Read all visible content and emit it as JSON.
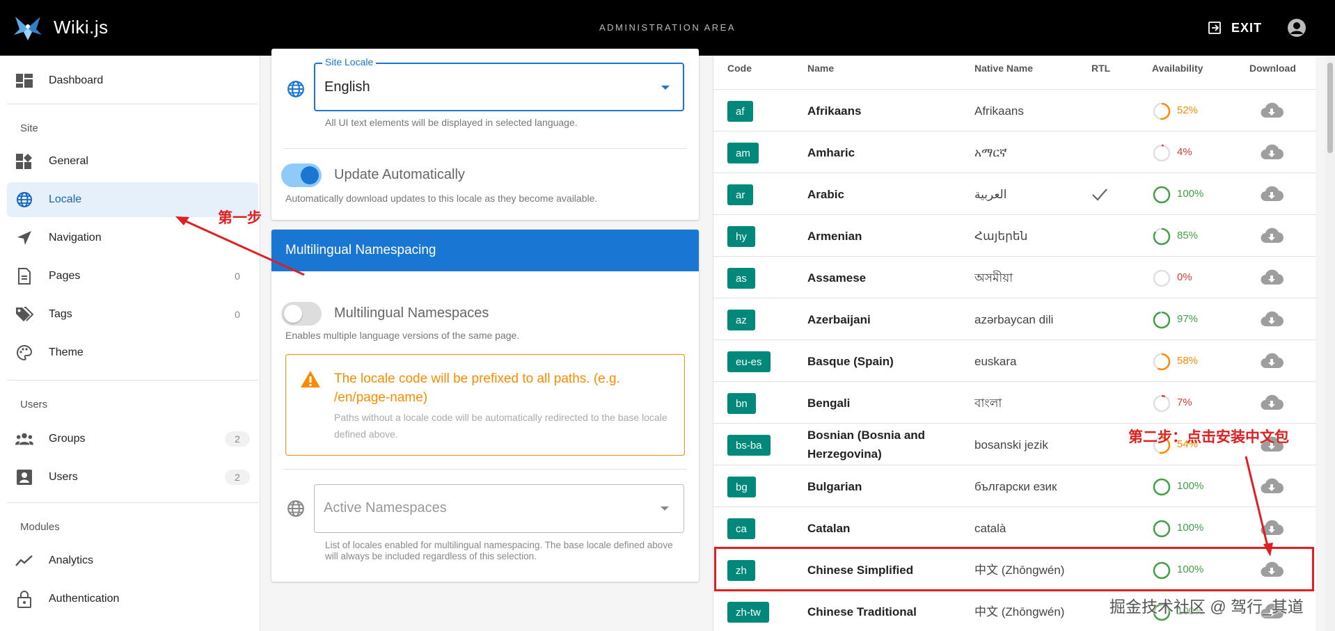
{
  "header": {
    "app_title": "Wiki.js",
    "admin_area": "ADMINISTRATION AREA",
    "exit_label": "EXIT"
  },
  "sidebar": {
    "dashboard": "Dashboard",
    "site_section": "Site",
    "general": "General",
    "locale": "Locale",
    "navigation": "Navigation",
    "pages": "Pages",
    "pages_count": "0",
    "tags": "Tags",
    "tags_count": "0",
    "theme": "Theme",
    "users_section": "Users",
    "groups": "Groups",
    "groups_count": "2",
    "users": "Users",
    "users_count": "2",
    "modules_section": "Modules",
    "analytics": "Analytics",
    "authentication": "Authentication"
  },
  "locale_card": {
    "site_locale_legend": "Site Locale",
    "site_locale_value": "English",
    "site_locale_hint": "All UI text elements will be displayed in selected language.",
    "update_label": "Update Automatically",
    "update_hint": "Automatically download updates to this locale as they become available.",
    "update_on": true
  },
  "namespace_card": {
    "header": "Multilingual Namespacing",
    "toggle_label": "Multilingual Namespaces",
    "toggle_hint": "Enables multiple language versions of the same page.",
    "alert_title": "The locale code will be prefixed to all paths. (e.g. /en/page-name)",
    "alert_body": "Paths without a locale code will be automatically redirected to the base locale defined above.",
    "active_ns_placeholder": "Active Namespaces",
    "active_ns_hint": "List of locales enabled for multilingual namespacing. The base locale defined above will always be included regardless of this selection."
  },
  "table": {
    "headers": [
      "Code",
      "Name",
      "Native Name",
      "RTL",
      "Availability",
      "Download"
    ],
    "rows": [
      {
        "code": "af",
        "name": "Afrikaans",
        "native": "Afrikaans",
        "rtl": false,
        "availability": 52
      },
      {
        "code": "am",
        "name": "Amharic",
        "native": "አማርኛ",
        "rtl": false,
        "availability": 4
      },
      {
        "code": "ar",
        "name": "Arabic",
        "native": "العربية",
        "rtl": true,
        "availability": 100
      },
      {
        "code": "hy",
        "name": "Armenian",
        "native": "Հայերեն",
        "rtl": false,
        "availability": 85
      },
      {
        "code": "as",
        "name": "Assamese",
        "native": "অসমীয়া",
        "rtl": false,
        "availability": 0
      },
      {
        "code": "az",
        "name": "Azerbaijani",
        "native": "azərbaycan dili",
        "rtl": false,
        "availability": 97
      },
      {
        "code": "eu-es",
        "name": "Basque (Spain)",
        "native": "euskara",
        "rtl": false,
        "availability": 58
      },
      {
        "code": "bn",
        "name": "Bengali",
        "native": "বাংলা",
        "rtl": false,
        "availability": 7
      },
      {
        "code": "bs-ba",
        "name": "Bosnian (Bosnia and Herzegovina)",
        "native": "bosanski jezik",
        "rtl": false,
        "availability": 54
      },
      {
        "code": "bg",
        "name": "Bulgarian",
        "native": "български език",
        "rtl": false,
        "availability": 100
      },
      {
        "code": "ca",
        "name": "Catalan",
        "native": "català",
        "rtl": false,
        "availability": 100
      },
      {
        "code": "zh",
        "name": "Chinese Simplified",
        "native": "中文 (Zhōngwén)",
        "rtl": false,
        "availability": 100
      },
      {
        "code": "zh-tw",
        "name": "Chinese Traditional",
        "native": "中文 (Zhōngwén)",
        "rtl": false,
        "availability": 100
      }
    ]
  },
  "annotations": {
    "step1": "第一步",
    "step2": "第二步：点击安装中文包",
    "watermark": "掘金技术社区 @ 驾行_其道"
  },
  "colors": {
    "accent": "#1976d2",
    "badge": "#00897b",
    "ok": "#43a047",
    "warn": "#fb8c00",
    "bad": "#e53935",
    "annotation": "#e02020"
  }
}
